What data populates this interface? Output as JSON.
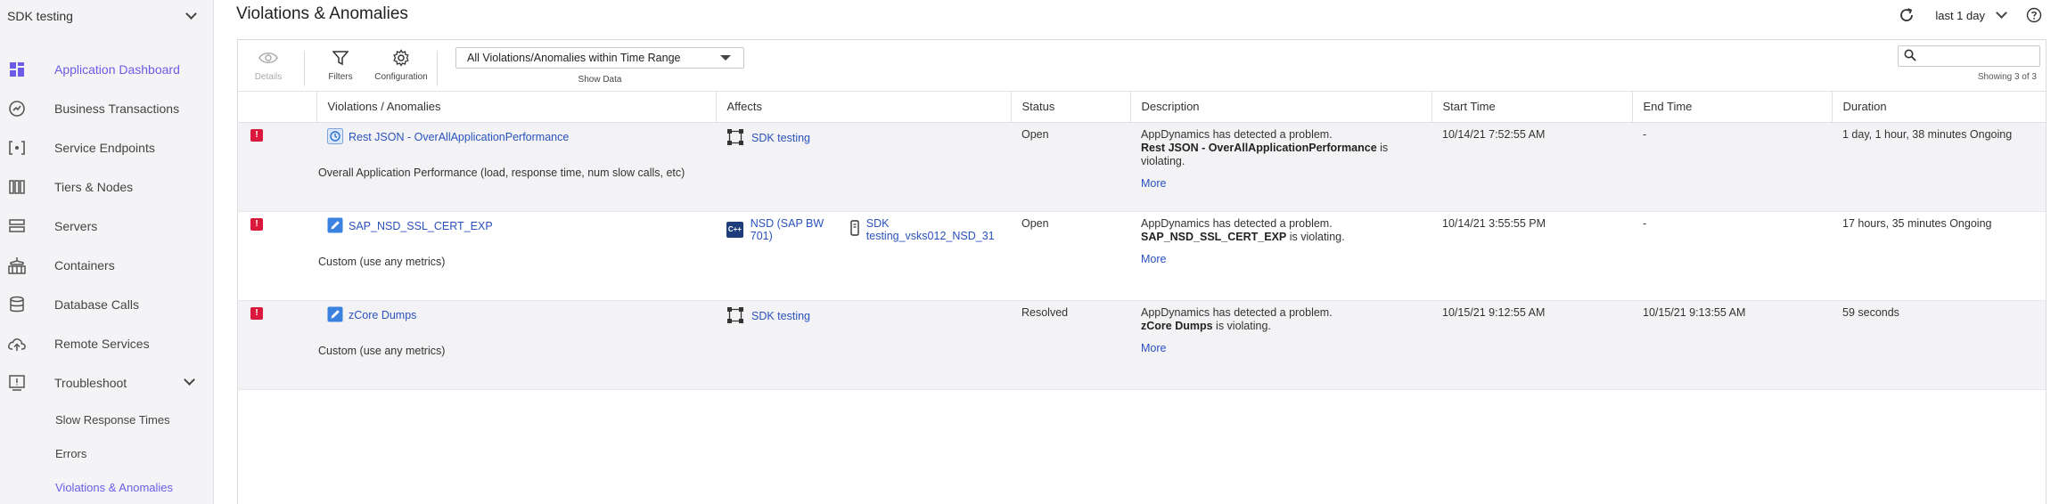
{
  "app": {
    "name": "SDK testing"
  },
  "sidebar": {
    "items": [
      {
        "label": "Application Dashboard",
        "icon": "dashboard-icon"
      },
      {
        "label": "Business Transactions",
        "icon": "business-transactions-icon"
      },
      {
        "label": "Service Endpoints",
        "icon": "service-endpoints-icon"
      },
      {
        "label": "Tiers & Nodes",
        "icon": "tiers-nodes-icon"
      },
      {
        "label": "Servers",
        "icon": "servers-icon"
      },
      {
        "label": "Containers",
        "icon": "containers-icon"
      },
      {
        "label": "Database Calls",
        "icon": "database-icon"
      },
      {
        "label": "Remote Services",
        "icon": "cloud-upload-icon"
      },
      {
        "label": "Troubleshoot",
        "icon": "troubleshoot-icon"
      }
    ],
    "sub_items": [
      {
        "label": "Slow Response Times"
      },
      {
        "label": "Errors"
      },
      {
        "label": "Violations & Anomalies"
      }
    ]
  },
  "header": {
    "title": "Violations & Anomalies",
    "time_range": "last 1 day"
  },
  "toolbar": {
    "details": "Details",
    "filters": "Filters",
    "configuration": "Configuration",
    "show_data_value": "All Violations/Anomalies within Time Range",
    "show_data_label": "Show Data",
    "search_placeholder": "",
    "showing": "Showing 3 of 3"
  },
  "table": {
    "columns": [
      "Violations / Anomalies",
      "Affects",
      "Status",
      "Description",
      "Start Time",
      "End Time",
      "Duration"
    ],
    "rows": [
      {
        "name": "Rest JSON - OverAllApplicationPerformance",
        "type": "Overall Application Performance (load, response time, num slow calls, etc)",
        "affects": [
          "SDK testing"
        ],
        "status": "Open",
        "desc_intro": "AppDynamics has detected a problem.",
        "desc_entity": "Rest JSON - OverAllApplicationPerformance",
        "desc_suffix": " is violating.",
        "more": "More",
        "start": "10/14/21 7:52:55 AM",
        "end": "-",
        "duration": "1 day, 1 hour, 38 minutes Ongoing"
      },
      {
        "name": "SAP_NSD_SSL_CERT_EXP",
        "type": "Custom (use any metrics)",
        "affects": [
          "NSD (SAP BW 701)",
          "SDK testing_vsks012_NSD_31"
        ],
        "status": "Open",
        "desc_intro": "AppDynamics has detected a problem.",
        "desc_entity": "SAP_NSD_SSL_CERT_EXP",
        "desc_suffix": " is violating.",
        "more": "More",
        "start": "10/14/21 3:55:55 PM",
        "end": "-",
        "duration": "17 hours, 35 minutes Ongoing"
      },
      {
        "name": "zCore Dumps",
        "type": "Custom (use any metrics)",
        "affects": [
          "SDK testing"
        ],
        "status": "Resolved",
        "desc_intro": "AppDynamics has detected a problem.",
        "desc_entity": "zCore Dumps",
        "desc_suffix": " is violating.",
        "more": "More",
        "start": "10/15/21 9:12:55 AM",
        "end": "10/15/21 9:13:55 AM",
        "duration": "59 seconds"
      }
    ]
  },
  "colors": {
    "accent": "#6b5be6",
    "link": "#2a52be",
    "critical": "#d9183b"
  }
}
